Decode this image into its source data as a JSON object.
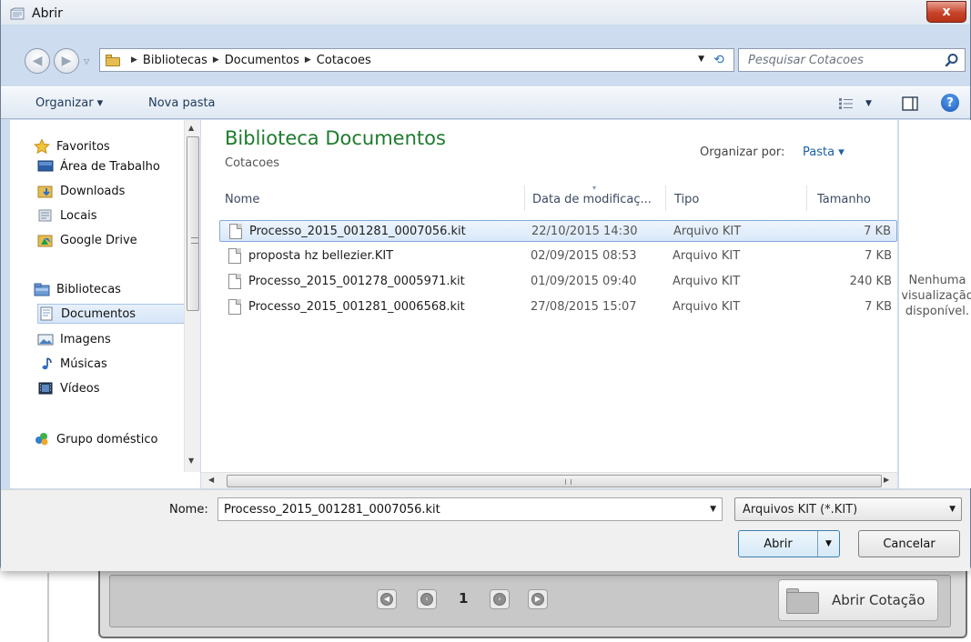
{
  "window": {
    "title": "Abrir",
    "close_label": "x"
  },
  "breadcrumb": [
    "Bibliotecas",
    "Documentos",
    "Cotacoes"
  ],
  "search": {
    "placeholder": "Pesquisar Cotacoes",
    "value": ""
  },
  "toolbar": {
    "organize_label": "Organizar ▾",
    "new_folder_label": "Nova pasta"
  },
  "sidebar": {
    "favorites_label": "Favoritos",
    "favorites": [
      "Área de Trabalho",
      "Downloads",
      "Locais",
      "Google Drive"
    ],
    "libraries_label": "Bibliotecas",
    "libraries": [
      "Documentos",
      "Imagens",
      "Músicas",
      "Vídeos"
    ],
    "homegroup_label": "Grupo doméstico",
    "selected": "Documentos"
  },
  "library": {
    "title": "Biblioteca Documentos",
    "subtitle": "Cotacoes",
    "arrange_label": "Organizar por:",
    "arrange_value": "Pasta ▾"
  },
  "columns": {
    "name": "Nome",
    "date": "Data de modificaç...",
    "type": "Tipo",
    "size": "Tamanho"
  },
  "files": [
    {
      "name": "Processo_2015_001281_0007056.kit",
      "date": "22/10/2015 14:30",
      "type": "Arquivo KIT",
      "size": "7 KB"
    },
    {
      "name": "proposta hz bellezier.KIT",
      "date": "02/09/2015 08:53",
      "type": "Arquivo KIT",
      "size": "7 KB"
    },
    {
      "name": "Processo_2015_001278_0005971.kit",
      "date": "01/09/2015 09:40",
      "type": "Arquivo KIT",
      "size": "240 KB"
    },
    {
      "name": "Processo_2015_001281_0006568.kit",
      "date": "27/08/2015 15:07",
      "type": "Arquivo KIT",
      "size": "7 KB"
    }
  ],
  "preview": {
    "line1": "Nenhuma",
    "line2": "visualização",
    "line3": "disponível."
  },
  "footer": {
    "name_label": "Nome:",
    "file_name": "Processo_2015_001281_0007056.kit",
    "file_type": "Arquivos KIT (*.KIT)",
    "open_label": "Abrir",
    "cancel_label": "Cancelar"
  },
  "background": {
    "page_number": "1",
    "open_quote_label": "Abrir Cotação"
  },
  "colors": {
    "library_title": "#1e7b2e",
    "selection": "#d9e8f9",
    "close_button": "#c7432a",
    "link": "#1d5fa8"
  }
}
